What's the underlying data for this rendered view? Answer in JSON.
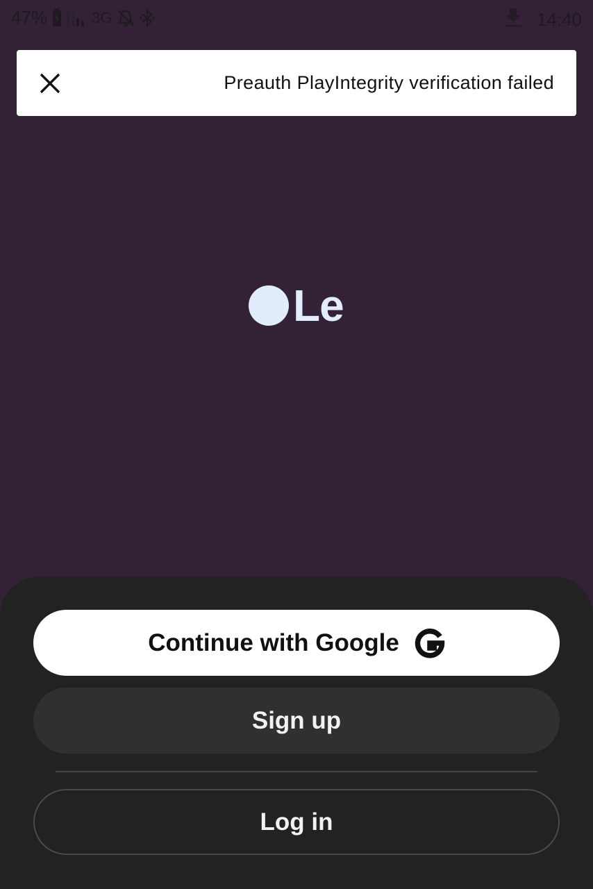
{
  "status_bar": {
    "battery_percent": "47%",
    "network": "3G",
    "time": "14:40",
    "icons": [
      "battery-charging-icon",
      "signal-icon",
      "notifications-off-icon",
      "bluetooth-icon",
      "download-icon"
    ]
  },
  "toast": {
    "message": "Preauth PlayIntegrity verification failed",
    "close_icon": "close-icon"
  },
  "logo": {
    "text": "Le",
    "color": "#e3ecfd"
  },
  "auth": {
    "google_label": "Continue with Google",
    "google_icon": "google-icon",
    "signup_label": "Sign up",
    "login_label": "Log in"
  },
  "colors": {
    "background": "#332236",
    "sheet": "#222222",
    "secondary_button": "#303030",
    "primary_button": "#ffffff"
  }
}
